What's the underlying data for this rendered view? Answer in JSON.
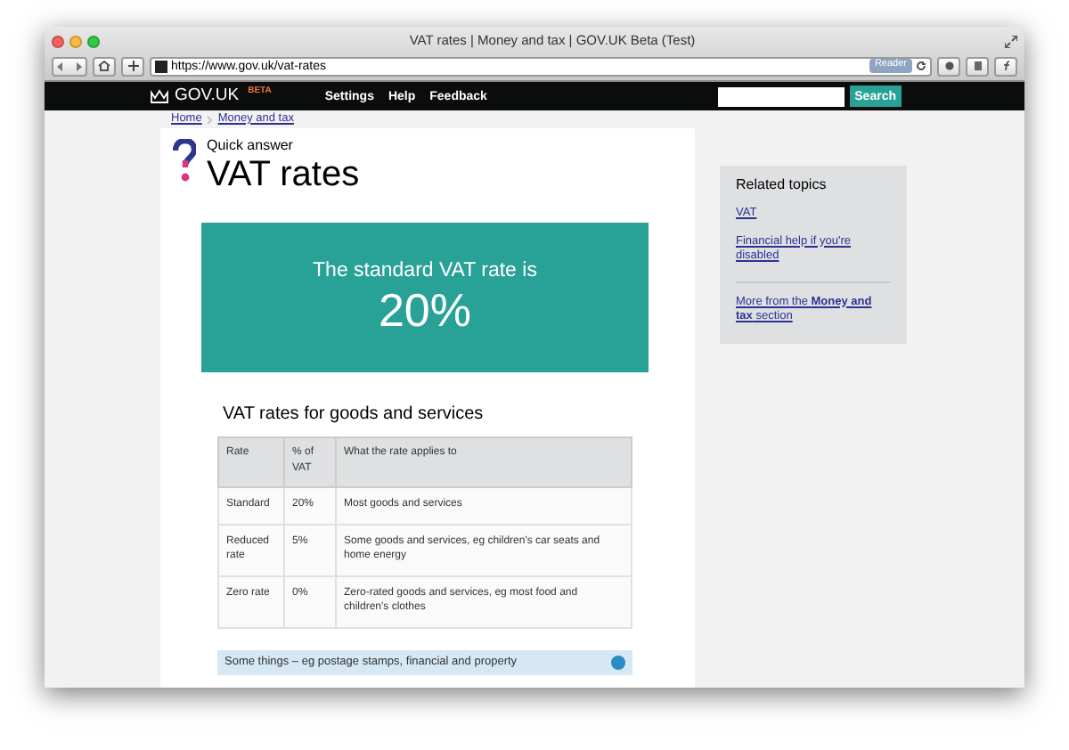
{
  "window": {
    "title": "VAT rates | Money and tax | GOV.UK Beta (Test)"
  },
  "toolbar": {
    "url": "https://www.gov.uk/vat-rates",
    "reader_badge": "Reader"
  },
  "header": {
    "logo": "GOV.UK",
    "badge": "BETA",
    "nav": [
      "Settings",
      "Help",
      "Feedback"
    ],
    "search_button": "Search"
  },
  "breadcrumbs": [
    "Home",
    "Money and tax"
  ],
  "article": {
    "kicker": "Quick answer",
    "title": "VAT rates",
    "highlight": {
      "lead": "The standard VAT rate is",
      "value": "20%"
    },
    "section_title": "VAT rates for goods and services",
    "table": {
      "columns": [
        "Rate",
        "% of VAT",
        "What the rate applies to"
      ],
      "rows": [
        [
          "Standard",
          "20%",
          "Most goods and services"
        ],
        [
          "Reduced rate",
          "5%",
          "Some goods and services, eg children's car seats and home energy"
        ],
        [
          "Zero rate",
          "0%",
          "Zero-rated goods and services, eg most food and children's clothes"
        ]
      ]
    },
    "callout": "Some things – eg postage stamps, financial and property"
  },
  "sidebar": {
    "title": "Related topics",
    "links": [
      "VAT",
      "Financial help if you're disabled"
    ],
    "more_link": "More from the **Money and tax** section"
  }
}
